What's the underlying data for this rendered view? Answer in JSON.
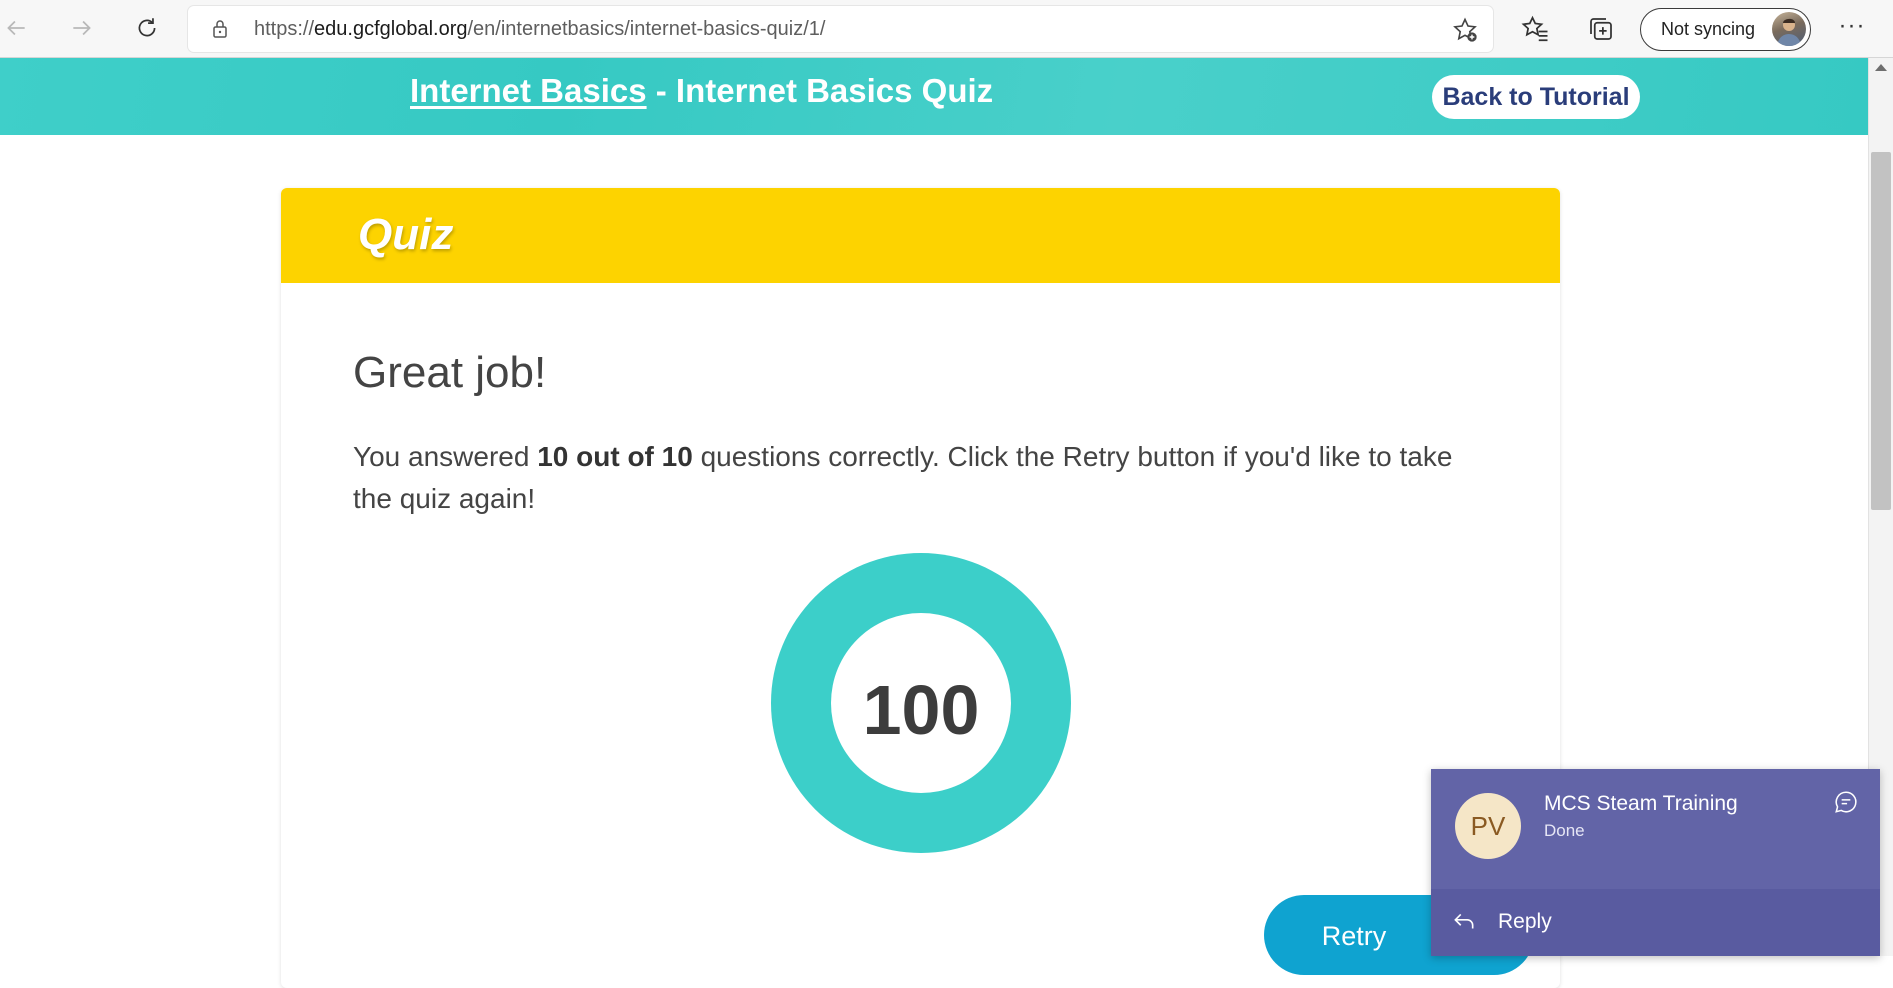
{
  "browser": {
    "url_prefix": "https://",
    "url_domain": "edu.gcfglobal.org",
    "url_path": "/en/internetbasics/internet-basics-quiz/1/",
    "sync_label": "Not syncing",
    "icons": [
      "back-arrow-icon",
      "forward-arrow-icon",
      "refresh-icon",
      "lock-icon",
      "add-favorite-icon",
      "favorites-icon",
      "collections-icon",
      "profile-avatar",
      "more-icon"
    ]
  },
  "header": {
    "course_link": "Internet Basics",
    "separator": " - ",
    "quiz_title": "Internet Basics Quiz",
    "back_button": "Back to Tutorial"
  },
  "quiz": {
    "heading": "Quiz",
    "result_title": "Great job!",
    "message_prefix": "You answered ",
    "message_score": "10 out of 10",
    "message_suffix": " questions correctly. Click the Retry button if you'd like to take the quiz again!",
    "score": "100",
    "retry_button": "Retry"
  },
  "notification": {
    "initials": "PV",
    "sender": "MCS Steam Training",
    "status": "Done",
    "reply_label": "Reply"
  },
  "colors": {
    "teal": "#36c9c3",
    "quiz_yellow": "#fdd300",
    "retry_blue": "#0fa3d0",
    "teams_purple": "#6264a7",
    "back_button_text": "#2a3d7a"
  }
}
